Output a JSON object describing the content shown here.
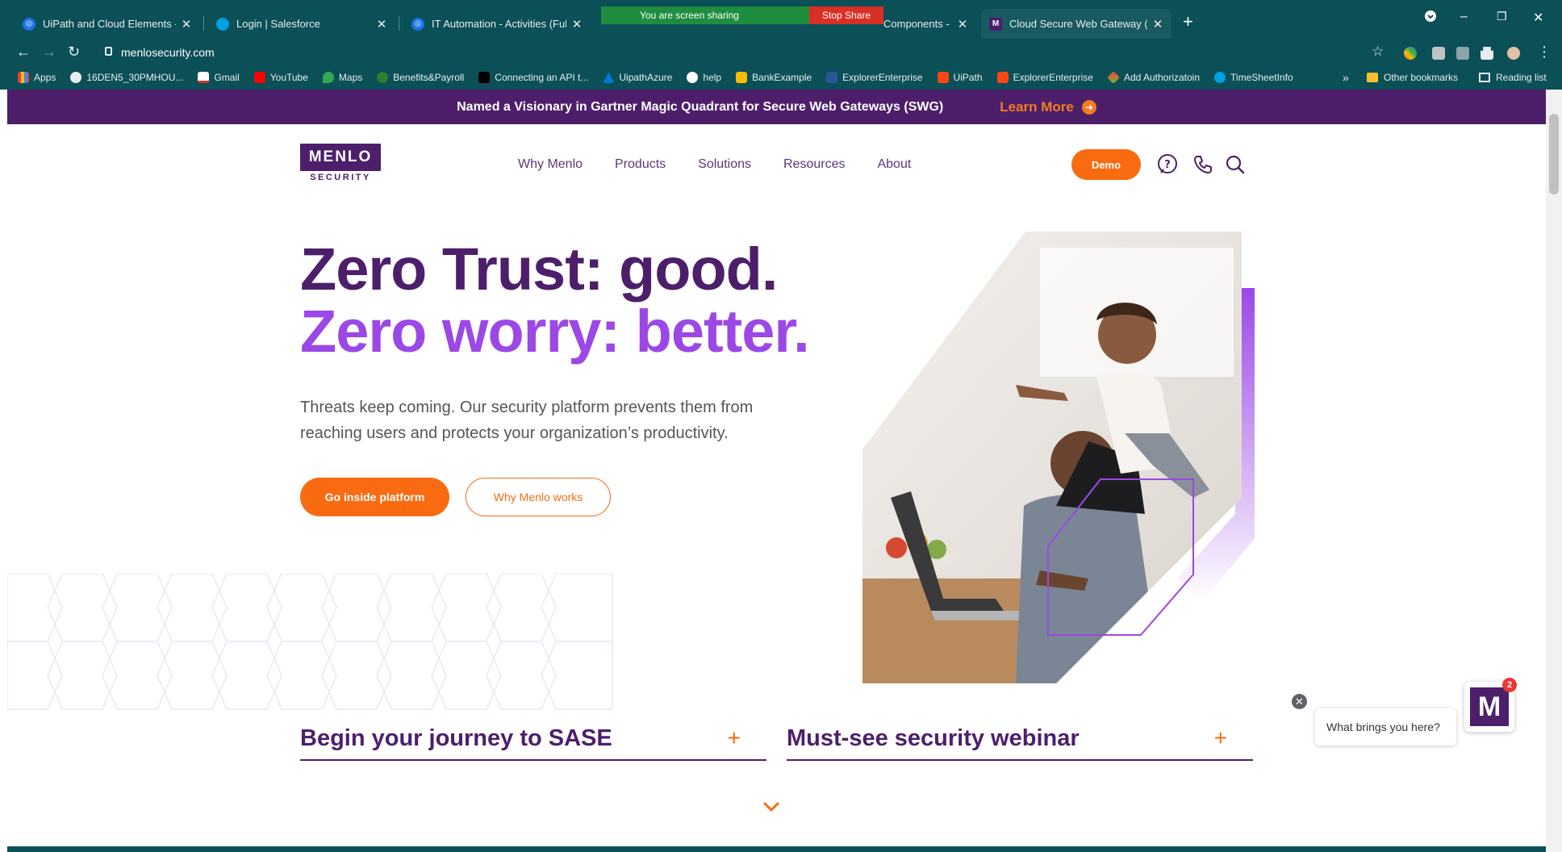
{
  "browser": {
    "tabs": [
      {
        "title": "UiPath and Cloud Elements - Cus",
        "favicon_color": "#1a73e8",
        "active": false
      },
      {
        "title": "Login | Salesforce",
        "favicon_color": "#00a1e0",
        "active": false
      },
      {
        "title": "IT Automation - Activities (Full Li",
        "favicon_color": "#1a73e8",
        "active": false
      },
      {
        "title": "Components - RP",
        "favicon_color": "#5a5a5a",
        "active": false
      },
      {
        "title": "Cloud Secure Web Gateway (SW",
        "favicon_color": "#4d1f6b",
        "active": true
      }
    ],
    "screen_share": {
      "message": "You are screen sharing",
      "stop_label": "Stop Share"
    },
    "new_tab": "+",
    "window_controls": {
      "minimize": "–",
      "restore": "❐",
      "close": "✕"
    },
    "url": "menlosecurity.com",
    "bookmarks": [
      {
        "label": "Apps",
        "color": "#ea4335"
      },
      {
        "label": "16DEN5_30PMHOU...",
        "color": "#e8eef0"
      },
      {
        "label": "Gmail",
        "color": "#d93025"
      },
      {
        "label": "YouTube",
        "color": "#ff0000"
      },
      {
        "label": "Maps",
        "color": "#34a853"
      },
      {
        "label": "Benefits&Payroll",
        "color": "#2e7d32"
      },
      {
        "label": "Connecting an API t...",
        "color": "#000000"
      },
      {
        "label": "UipathAzure",
        "color": "#0078d4"
      },
      {
        "label": "help",
        "color": "#24292e"
      },
      {
        "label": "BankExample",
        "color": "#fbbc04"
      },
      {
        "label": "ExplorerEnterprise",
        "color": "#2b579a"
      },
      {
        "label": "UiPath",
        "color": "#fa4616"
      },
      {
        "label": "ExplorerEnterprise",
        "color": "#fa4616"
      },
      {
        "label": "Add Authorizatoin",
        "color": "#7cb342"
      },
      {
        "label": "TimeSheetInfo",
        "color": "#00a1e0"
      }
    ],
    "bookmarks_overflow": "»",
    "other_bookmarks": "Other bookmarks",
    "reading_list": "Reading list"
  },
  "banner": {
    "text": "Named a Visionary in Gartner Magic Quadrant for Secure Web Gateways (SWG)",
    "link": "Learn More"
  },
  "header": {
    "logo_top": "MENLO",
    "logo_bottom": "SECURITY",
    "nav": [
      "Why Menlo",
      "Products",
      "Solutions",
      "Resources",
      "About"
    ],
    "demo_label": "Demo"
  },
  "hero": {
    "line1": "Zero Trust: good.",
    "line2": "Zero worry: better.",
    "subtitle": "Threats keep coming. Our security platform prevents them from reaching users and protects your organization’s productivity.",
    "primary_cta": "Go inside platform",
    "secondary_cta": "Why Menlo works"
  },
  "accordions": [
    {
      "title": "Begin your journey to SASE",
      "icon": "+"
    },
    {
      "title": "Must-see security webinar",
      "icon": "+"
    }
  ],
  "chat": {
    "prompt": "What brings you here?",
    "badge_count": "2",
    "close": "✕",
    "logo_letter": "M"
  },
  "colors": {
    "brand_purple": "#4d1f6b",
    "accent_purple": "#9b48e6",
    "brand_orange": "#f96b11",
    "chrome_teal": "#0b4f57"
  }
}
